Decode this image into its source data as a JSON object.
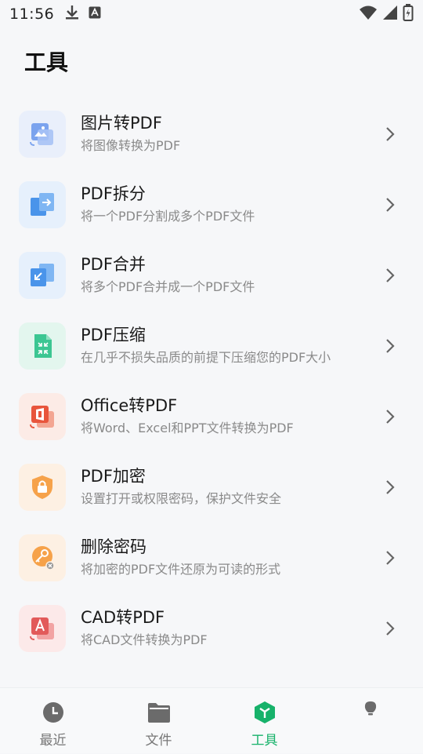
{
  "status_bar": {
    "time": "11:56",
    "icons": [
      "download-icon",
      "font-a-icon",
      "wifi-icon",
      "signal-icon",
      "battery-charging-icon"
    ]
  },
  "header": {
    "title": "工具"
  },
  "tools": [
    {
      "title": "图片转PDF",
      "desc": "将图像转换为PDF",
      "icon": "image-to-pdf-icon",
      "color": "#6f9ae8",
      "bg": "#e9effb"
    },
    {
      "title": "PDF拆分",
      "desc": "将一个PDF分割成多个PDF文件",
      "icon": "pdf-split-icon",
      "color": "#3e8de6",
      "bg": "#e6f0fc"
    },
    {
      "title": "PDF合并",
      "desc": "将多个PDF合并成一个PDF文件",
      "icon": "pdf-merge-icon",
      "color": "#3e8de6",
      "bg": "#e6f0fc"
    },
    {
      "title": "PDF压缩",
      "desc": "在几乎不损失品质的前提下压缩您的PDF大小",
      "icon": "pdf-compress-icon",
      "color": "#34c28e",
      "bg": "#e3f6ee"
    },
    {
      "title": "Office转PDF",
      "desc": "将Word、Excel和PPT文件转换为PDF",
      "icon": "office-to-pdf-icon",
      "color": "#e8553c",
      "bg": "#fcebe6"
    },
    {
      "title": "PDF加密",
      "desc": "设置打开或权限密码，保护文件安全",
      "icon": "pdf-encrypt-icon",
      "color": "#f39a3c",
      "bg": "#fdf0e3"
    },
    {
      "title": "删除密码",
      "desc": "将加密的PDF文件还原为可读的形式",
      "icon": "remove-password-icon",
      "color": "#f39a3c",
      "bg": "#fdf0e3"
    },
    {
      "title": "CAD转PDF",
      "desc": "将CAD文件转换为PDF",
      "icon": "cad-to-pdf-icon",
      "color": "#e25a5a",
      "bg": "#fce9e9"
    }
  ],
  "bottom_nav": {
    "items": [
      {
        "label": "最近",
        "icon": "clock-icon",
        "active": false
      },
      {
        "label": "文件",
        "icon": "folder-icon",
        "active": false
      },
      {
        "label": "工具",
        "icon": "tools-icon",
        "active": true
      },
      {
        "label": "",
        "icon": "bulb-icon",
        "active": false
      }
    ]
  },
  "colors": {
    "accent": "#17b26a",
    "muted": "#8a8a8a"
  }
}
